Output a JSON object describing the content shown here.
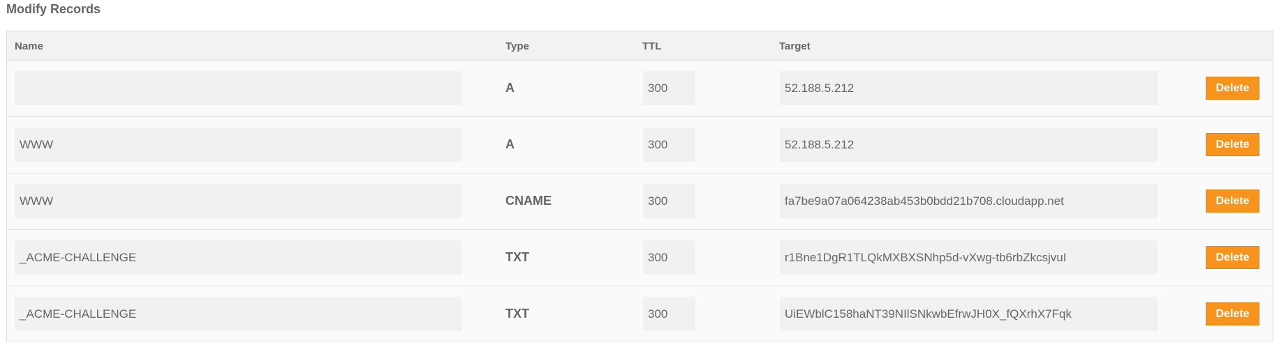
{
  "section": {
    "title": "Modify Records"
  },
  "table": {
    "headers": {
      "name": "Name",
      "type": "Type",
      "ttl": "TTL",
      "target": "Target"
    },
    "delete_label": "Delete",
    "rows": [
      {
        "name": "",
        "type": "A",
        "ttl": "300",
        "target": "52.188.5.212"
      },
      {
        "name": "WWW",
        "type": "A",
        "ttl": "300",
        "target": "52.188.5.212"
      },
      {
        "name": "WWW",
        "type": "CNAME",
        "ttl": "300",
        "target": "fa7be9a07a064238ab453b0bdd21b708.cloudapp.net"
      },
      {
        "name": "_ACME-CHALLENGE",
        "type": "TXT",
        "ttl": "300",
        "target": "r1Bne1DgR1TLQkMXBXSNhp5d-vXwg-tb6rbZkcsjvuI"
      },
      {
        "name": "_ACME-CHALLENGE",
        "type": "TXT",
        "ttl": "300",
        "target": "UiEWblC158haNT39NIlSNkwbEfrwJH0X_fQXrhX7Fqk"
      }
    ]
  },
  "colors": {
    "delete_button": "#f7941d",
    "field_background": "#f1f1f1"
  }
}
